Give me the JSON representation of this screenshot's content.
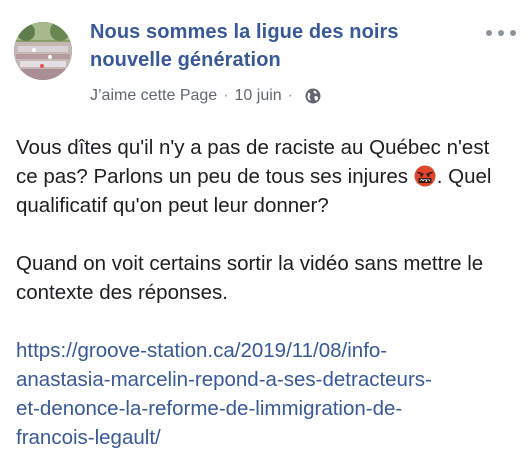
{
  "post": {
    "page_name_line1": "Nous sommes la ligue des noirs",
    "page_name_line2": "nouvelle génération",
    "like_page": "J’aime cette Page",
    "date": "10 juin",
    "separator": "·",
    "paragraph1_part1": "Vous dîtes qu'il n'y a pas de raciste au Québec n'est ce pas? Parlons un peu de tous ses injures",
    "emoji": "angry-face-with-symbols-icon",
    "paragraph1_part2": ". Quel qualificatif qu'on peut leur donner?",
    "paragraph2": "Quand on voit certains sortir la vidéo sans mettre le contexte des réponses.",
    "link_line1": "https://groove-station.ca/2019/11/08/info-",
    "link_line2": "anastasia-marcelin-repond-a-ses-detracteurs-",
    "link_line3": "et-denonce-la-reforme-de-limmigration-de-",
    "link_line4": "francois-legault/"
  },
  "colors": {
    "link_blue": "#385898",
    "meta_gray": "#616770",
    "text": "#1c1e21"
  }
}
